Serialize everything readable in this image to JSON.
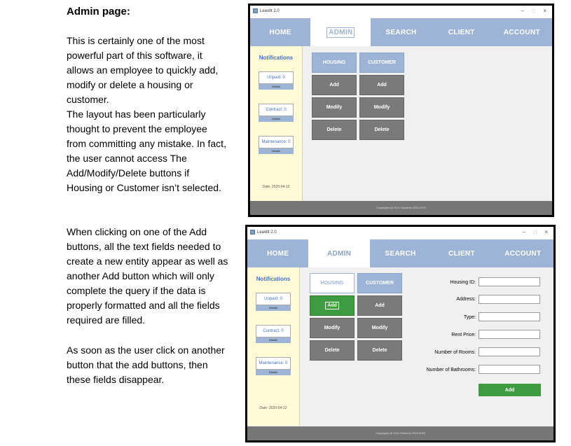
{
  "doc": {
    "heading": "Admin page:",
    "para1": [
      "This is certainly one of the most",
      "powerful part of this software, it",
      "allows an employee to quickly add,",
      "modify or delete a housing or",
      "customer.",
      "The layout has been particularly",
      "thought to prevent the employee",
      "from committing any mistake. In fact,",
      "the user cannot access The",
      "Add/Modify/Delete buttons if",
      "Housing or Customer isn’t selected."
    ],
    "para2": [
      "When clicking on one of the Add",
      "buttons, all the text fields needed to",
      "create a new entity appear as well as",
      "another Add button which will only",
      "complete the query if the data is",
      "properly formatted and all the fields",
      "required are filled."
    ],
    "para3": [
      "As soon as the user click on another",
      "button that the add buttons, then",
      "these fields disappear."
    ]
  },
  "app": {
    "window_title": "Leavitt 2.0",
    "nav": [
      "HOME",
      "ADMIN",
      "SEARCH",
      "CLIENT",
      "ACCOUNT"
    ],
    "notifications_title": "Notifications",
    "notifs": [
      "Unpaid: 0",
      "Contract: 0",
      "Maintenance: 0"
    ],
    "details": "Details",
    "date": "Date: 2020-04-12",
    "footer": "Copyrights @ SUU Students 2019-2020",
    "housing": "HOUSING",
    "customer": "CUSTOMER",
    "add": "Add",
    "modify": "Modify",
    "delete": "Delete",
    "minimize": "–",
    "maximize": "□",
    "close": "×"
  },
  "form": {
    "labels": [
      "Housing ID:",
      "Address:",
      "Type:",
      "Rent Price:",
      "Number of Rooms:",
      "Number of Bathrooms:"
    ],
    "submit": "Add"
  }
}
